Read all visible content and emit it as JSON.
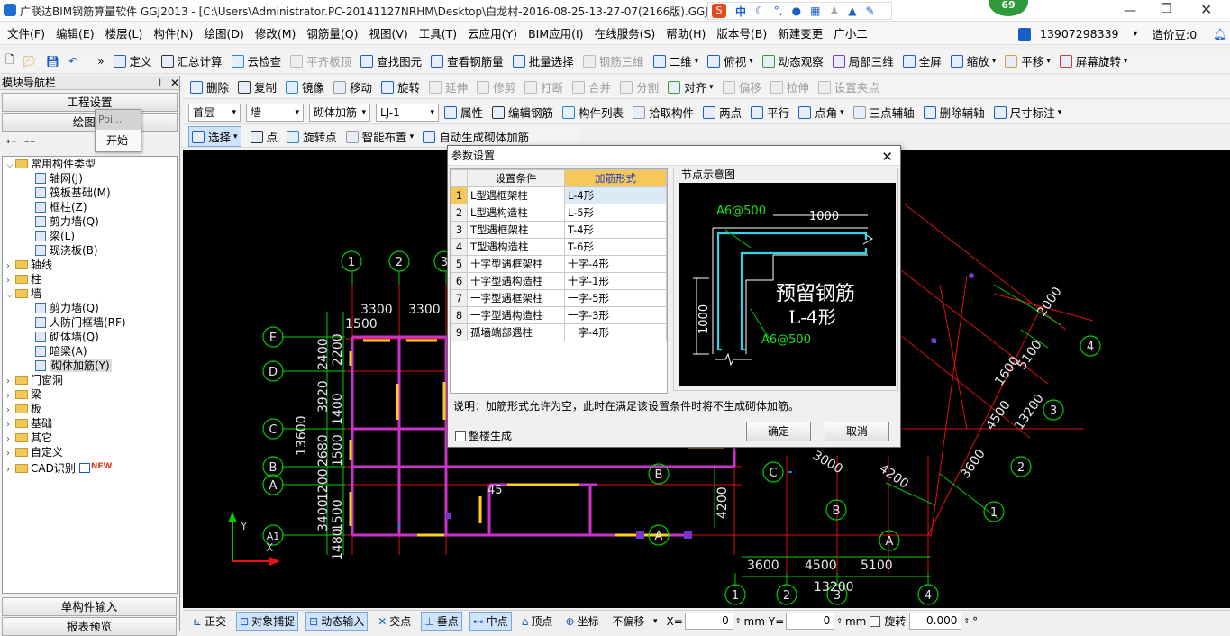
{
  "window": {
    "title": "广联达BIM钢筋算量软件 GGJ2013 - [C:\\Users\\Administrator.PC-20141127NRHM\\Desktop\\白龙村-2016-08-25-13-27-07(2166版).GGJ1",
    "badge": "69",
    "ime": "中"
  },
  "menu": [
    "文件(F)",
    "编辑(E)",
    "楼层(L)",
    "构件(N)",
    "绘图(D)",
    "修改(M)",
    "钢筋量(Q)",
    "视图(V)",
    "工具(T)",
    "云应用(Y)",
    "BIM应用(I)",
    "在线服务(S)",
    "帮助(H)",
    "版本号(B)",
    "新建变更",
    "广小二"
  ],
  "account": {
    "phone": "13907298339",
    "bean": "造价豆:0"
  },
  "toolbar1": {
    "items": [
      "定义",
      "汇总计算",
      "云检查",
      "平齐板顶",
      "查找图元",
      "查看钢筋量",
      "批量选择",
      "钢筋三维",
      "二维",
      "俯视",
      "动态观察",
      "局部三维",
      "全屏",
      "缩放",
      "平移",
      "屏幕旋转"
    ]
  },
  "toolbar2": {
    "items": [
      "删除",
      "复制",
      "镜像",
      "移动",
      "旋转",
      "延伸",
      "修剪",
      "打断",
      "合并",
      "分割",
      "对齐",
      "偏移",
      "拉伸",
      "设置夹点"
    ]
  },
  "toolbar3": {
    "floor": "首层",
    "type": "墙",
    "sub": "砌体加筋",
    "name": "LJ-1",
    "items": [
      "属性",
      "编辑钢筋",
      "构件列表",
      "拾取构件",
      "两点",
      "平行",
      "点角",
      "三点辅轴",
      "删除辅轴",
      "尺寸标注"
    ]
  },
  "toolbar4": {
    "items": [
      "选择",
      "点",
      "旋转点",
      "智能布置",
      "自动生成砌体加筋"
    ]
  },
  "nav": {
    "title": "模块导航栏",
    "btn_eng": "工程设置",
    "btn_draw": "绘图输",
    "popup_item": "Poi...",
    "popup_start": "开始",
    "tree": [
      {
        "label": "常用构件类型",
        "level": 0,
        "folder": true,
        "open": true
      },
      {
        "label": "轴网(J)",
        "level": 1
      },
      {
        "label": "筏板基础(M)",
        "level": 1
      },
      {
        "label": "框柱(Z)",
        "level": 1
      },
      {
        "label": "剪力墙(Q)",
        "level": 1
      },
      {
        "label": "梁(L)",
        "level": 1
      },
      {
        "label": "现浇板(B)",
        "level": 1
      },
      {
        "label": "轴线",
        "level": 0,
        "folder": true
      },
      {
        "label": "柱",
        "level": 0,
        "folder": true
      },
      {
        "label": "墙",
        "level": 0,
        "folder": true,
        "open": true
      },
      {
        "label": "剪力墙(Q)",
        "level": 1
      },
      {
        "label": "人防门框墙(RF)",
        "level": 1
      },
      {
        "label": "砌体墙(Q)",
        "level": 1
      },
      {
        "label": "暗梁(A)",
        "level": 1
      },
      {
        "label": "砌体加筋(Y)",
        "level": 1,
        "selected": true
      },
      {
        "label": "门窗洞",
        "level": 0,
        "folder": true
      },
      {
        "label": "梁",
        "level": 0,
        "folder": true
      },
      {
        "label": "板",
        "level": 0,
        "folder": true
      },
      {
        "label": "基础",
        "level": 0,
        "folder": true
      },
      {
        "label": "其它",
        "level": 0,
        "folder": true
      },
      {
        "label": "自定义",
        "level": 0,
        "folder": true
      },
      {
        "label": "CAD识别",
        "level": 0,
        "folder": true,
        "new": "NEW"
      }
    ],
    "btn_single": "单构件输入",
    "btn_report": "报表预览"
  },
  "dialog": {
    "title": "参数设置",
    "col1": "设置条件",
    "col2": "加筋形式",
    "rows": [
      {
        "n": "1",
        "cond": "L型遇框架柱",
        "form": "L-4形"
      },
      {
        "n": "2",
        "cond": "L型遇构造柱",
        "form": "L-5形"
      },
      {
        "n": "3",
        "cond": "T型遇框架柱",
        "form": "T-4形"
      },
      {
        "n": "4",
        "cond": "T型遇构造柱",
        "form": "T-6形"
      },
      {
        "n": "5",
        "cond": "十字型遇框架柱",
        "form": "十字-4形"
      },
      {
        "n": "6",
        "cond": "十字型遇构造柱",
        "form": "十字-1形"
      },
      {
        "n": "7",
        "cond": "一字型遇框架柱",
        "form": "一字-5形"
      },
      {
        "n": "8",
        "cond": "一字型遇构造柱",
        "form": "一字-3形"
      },
      {
        "n": "9",
        "cond": "孤墙端部遇柱",
        "form": "一字-4形"
      }
    ],
    "preview_title": "节点示意图",
    "preview_text1": "预留钢筋",
    "preview_text2": "L-4形",
    "preview_a1": "A6@500",
    "preview_a2": "A6@500",
    "preview_d1": "1000",
    "preview_d2": "1000",
    "note": "说明：加筋形式允许为空，此时在满足该设置条件时将不生成砌体加筋。",
    "checkbox": "整楼生成",
    "ok": "确定",
    "cancel": "取消"
  },
  "cad": {
    "dims": [
      "3300",
      "3300",
      "1500",
      "2400",
      "2200",
      "3920",
      "1400",
      "13600",
      "2680",
      "1500",
      "1200",
      "3400",
      "1500",
      "1480",
      "4200",
      "3600",
      "4500",
      "5100",
      "13200",
      "2000",
      "5100",
      "1600",
      "4500",
      "13200",
      "3600",
      "4200",
      "3000",
      "45"
    ],
    "axes": [
      "1",
      "2",
      "3",
      "E",
      "D",
      "C",
      "B",
      "A",
      "A1",
      "B",
      "C",
      "B",
      "A",
      "1",
      "2",
      "3",
      "4",
      "4",
      "3",
      "2",
      "1"
    ]
  },
  "statusbar": {
    "items": [
      "正交",
      "对象捕捉",
      "动态输入",
      "交点",
      "垂点",
      "中点",
      "顶点",
      "坐标"
    ],
    "offset": "不偏移",
    "x_label": "X=",
    "x_val": "0",
    "y_label": "Y=",
    "y_val": "0",
    "unit": "mm",
    "rotate": "旋转",
    "rotate_val": "0.000",
    "deg": "°"
  }
}
